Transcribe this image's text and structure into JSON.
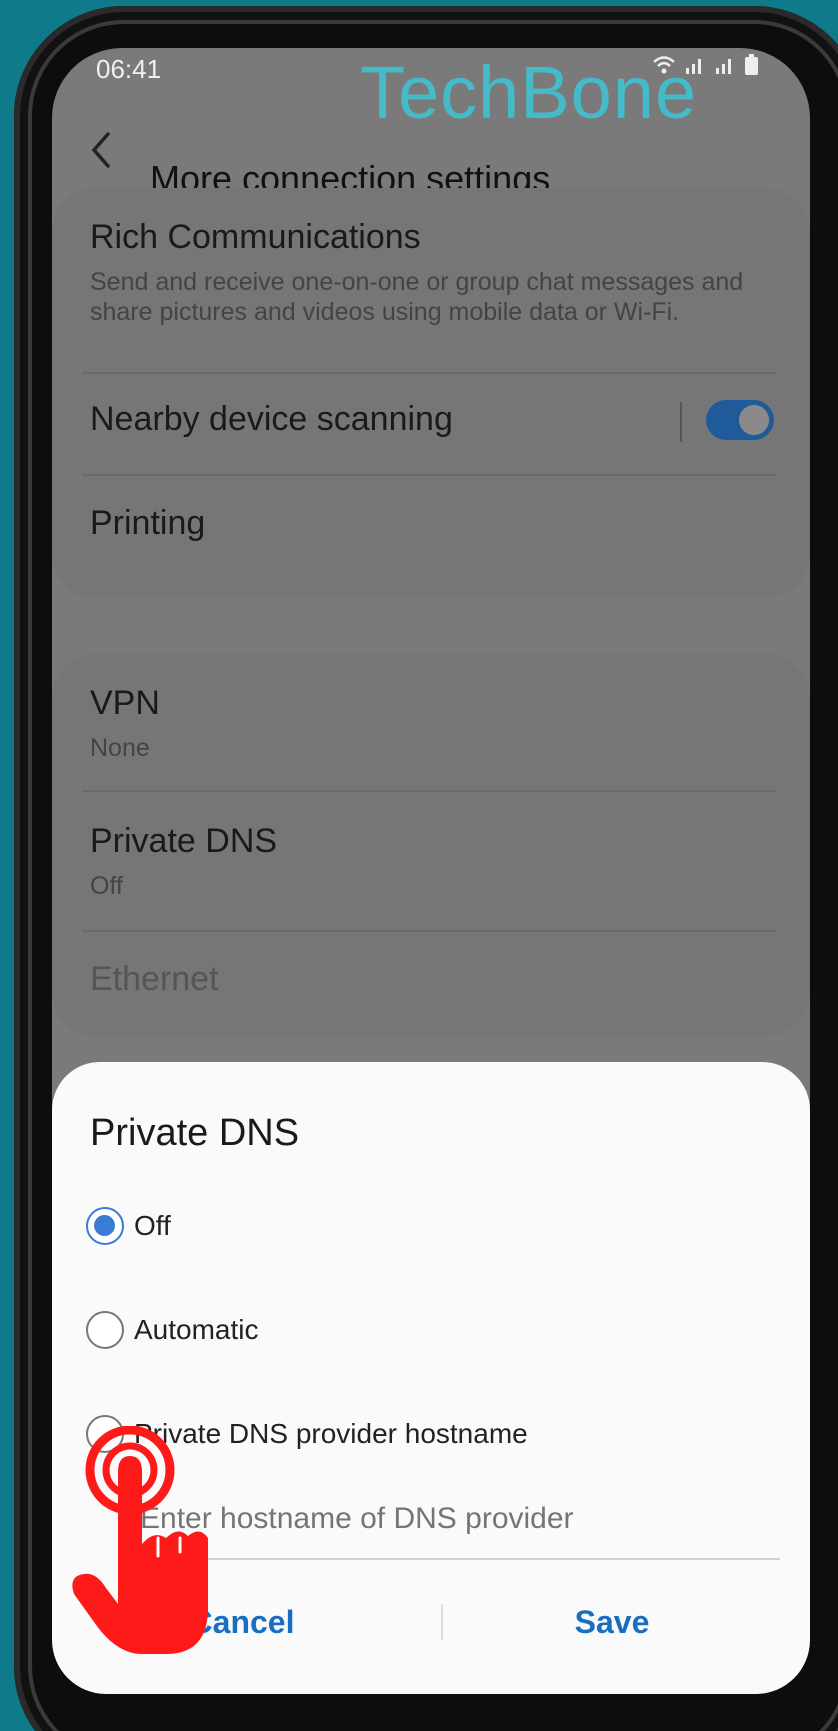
{
  "status_bar": {
    "time": "06:41",
    "icons": "wifi-icon signal-icon signal-icon battery-icon"
  },
  "watermark": "TechBone",
  "header": {
    "back_icon": "back-arrow-icon",
    "title": "More connection settings"
  },
  "group1": {
    "rich_communications": {
      "title": "Rich Communications",
      "subtitle": "Send and receive one-on-one or group chat messages and share pictures and videos using mobile data or Wi-Fi."
    },
    "nearby_scanning": {
      "title": "Nearby device scanning",
      "toggle_on": true
    },
    "printing": {
      "title": "Printing"
    }
  },
  "group2": {
    "vpn": {
      "title": "VPN",
      "subtitle": "None"
    },
    "private_dns": {
      "title": "Private DNS",
      "subtitle": "Off"
    },
    "ethernet": {
      "title": "Ethernet"
    }
  },
  "dialog": {
    "title": "Private DNS",
    "options": [
      {
        "label": "Off",
        "selected": true
      },
      {
        "label": "Automatic",
        "selected": false
      },
      {
        "label": "Private DNS provider hostname",
        "selected": false
      }
    ],
    "hostname_placeholder": "Enter hostname of DNS provider",
    "cancel_label": "Cancel",
    "save_label": "Save"
  },
  "colors": {
    "background": "#0f7a8a",
    "accent": "#1a6ec2",
    "radio_selected": "#3a7bd5",
    "tap_indicator": "#ff1a1a",
    "watermark": "#3cc6d6"
  }
}
